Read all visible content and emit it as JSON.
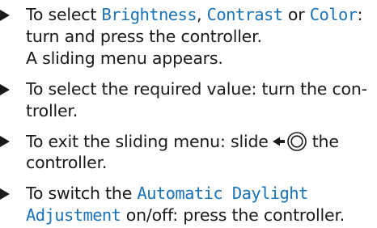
{
  "steps": [
    {
      "line1": {
        "intro": "To select ",
        "opt1": "Brightness",
        "sep1": ", ",
        "opt2": "Contrast",
        "sep2": " or ",
        "opt3": "Color",
        "end": ":"
      },
      "line2": "turn and press the controller.",
      "line3": "A sliding menu appears."
    },
    {
      "line1": "To select the required value: turn the con-",
      "line2": "troller."
    },
    {
      "line1_before": "To exit the sliding menu: slide",
      "line1_after": "the",
      "line2": "controller.",
      "icon": "slide-left-controller-icon"
    },
    {
      "line1_before": "To switch the ",
      "setting_part1": "Automatic Daylight",
      "setting_part2": "Adjustment",
      "line2_after": " on/off: press the controller."
    }
  ],
  "colors": {
    "text": "#1a1a1a",
    "highlight": "#1a73b8"
  }
}
